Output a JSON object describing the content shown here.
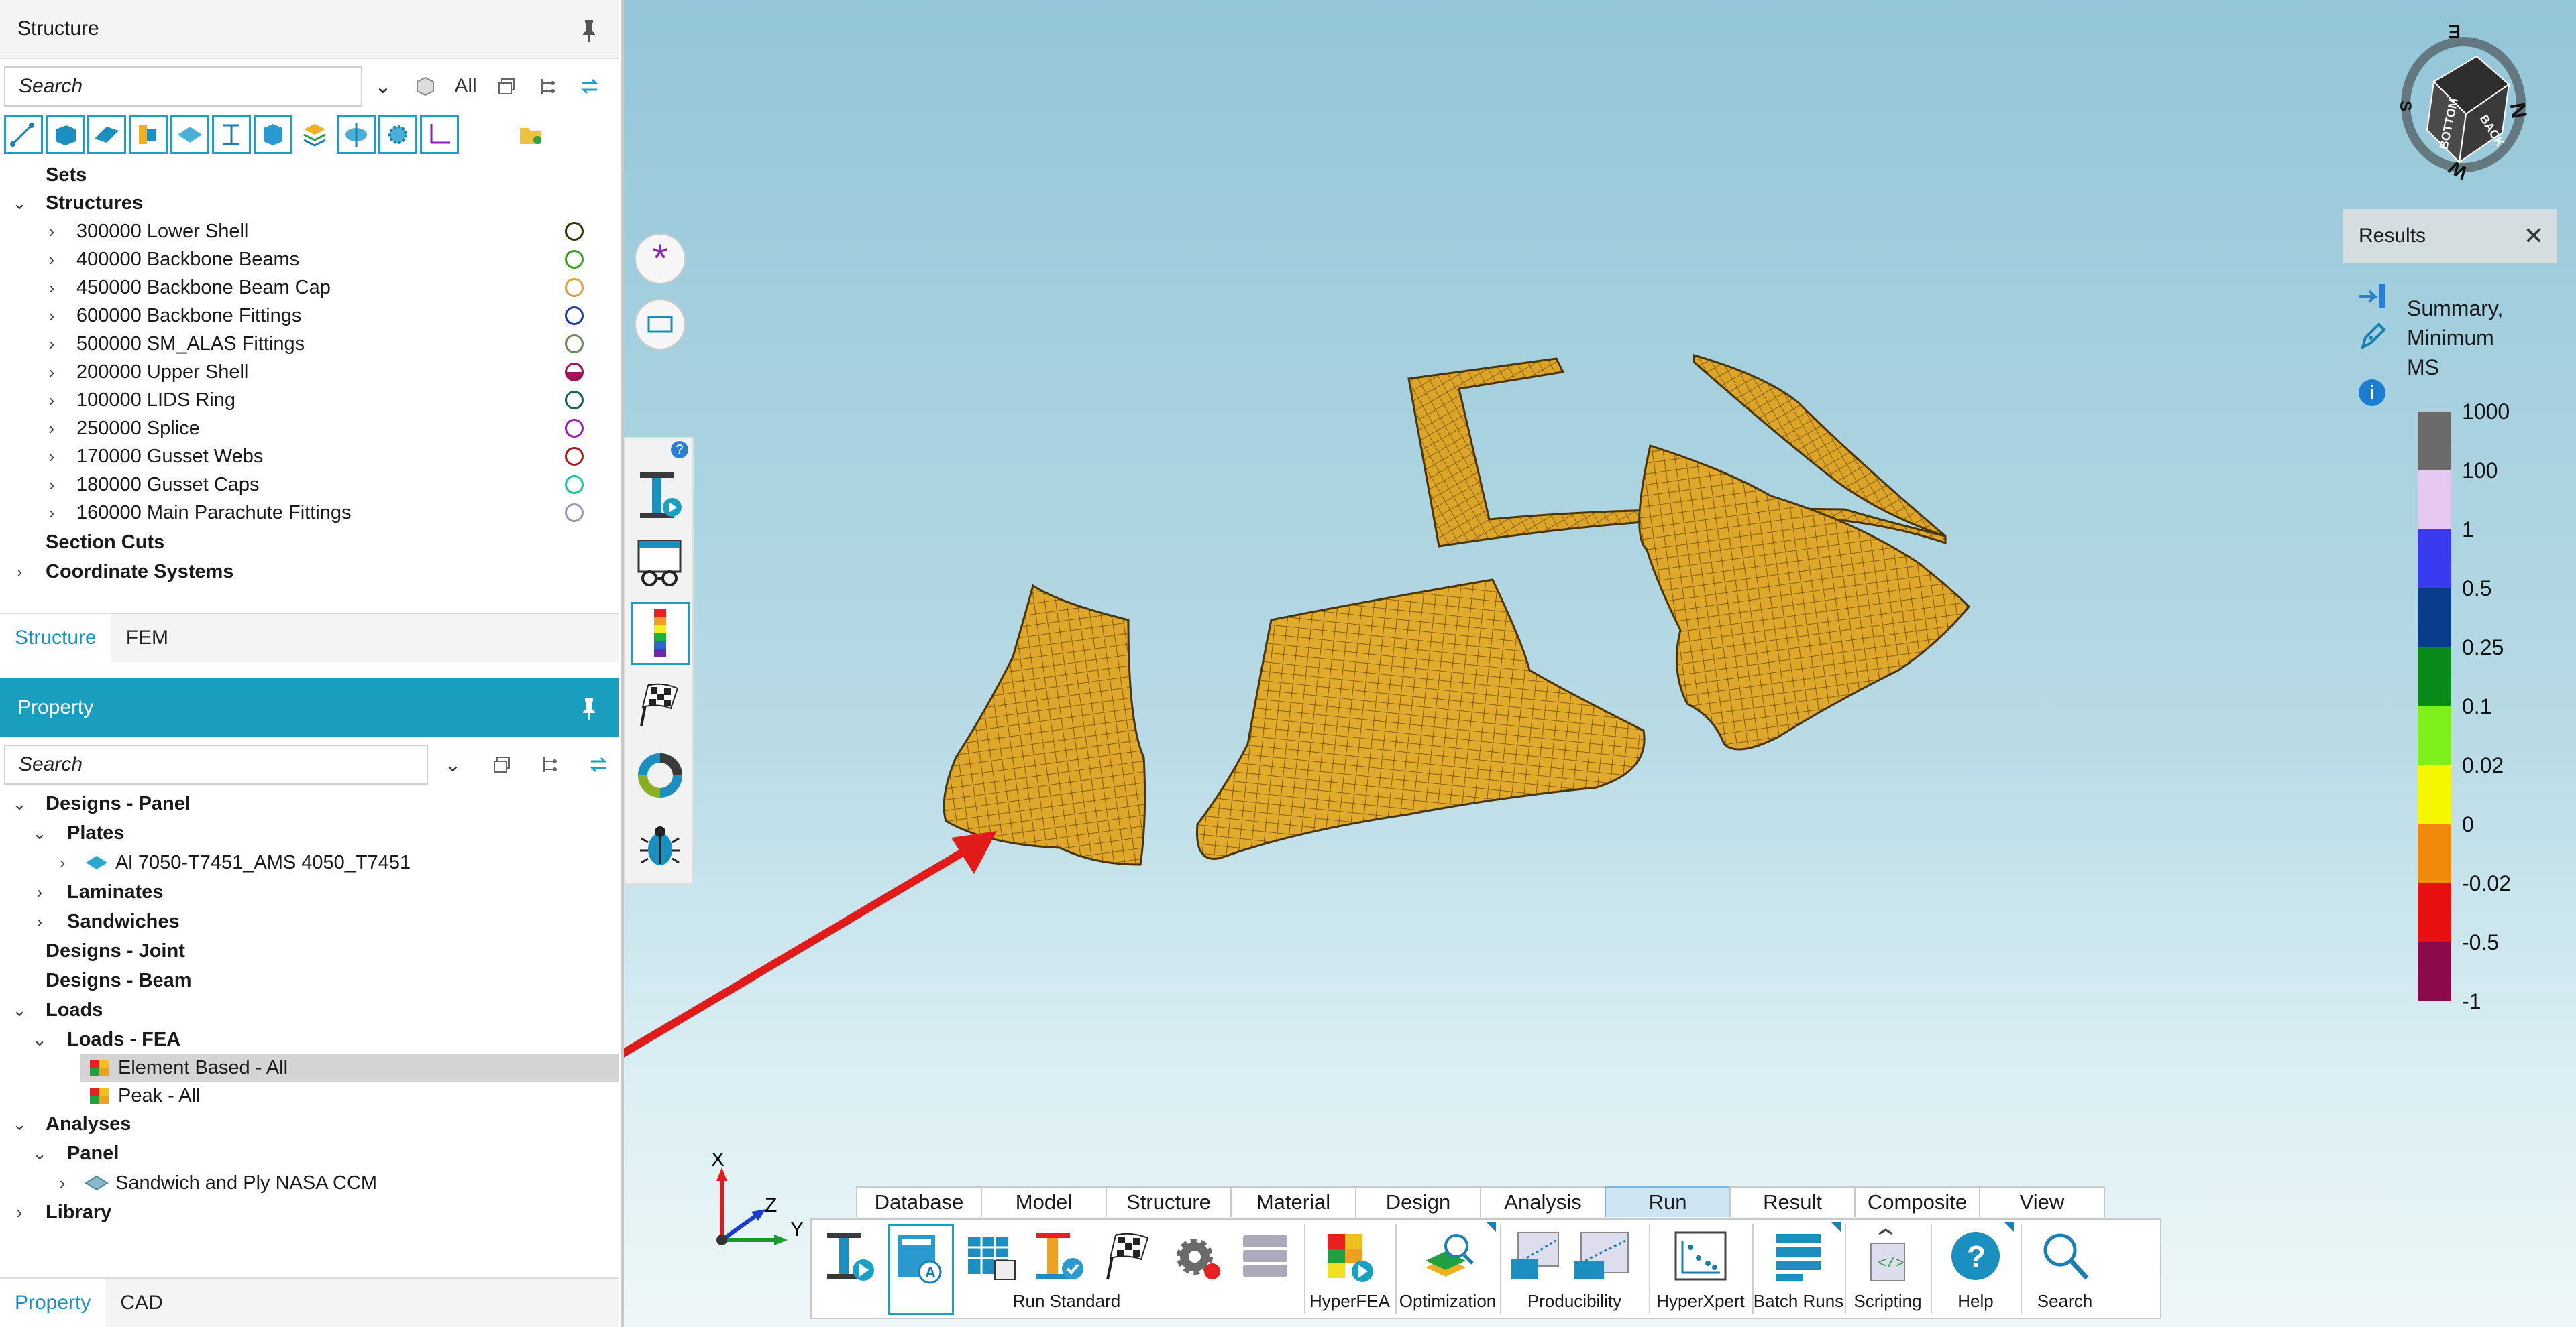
{
  "structure_panel": {
    "title": "Structure",
    "search_placeholder": "Search",
    "filter_all": "All",
    "tree": {
      "sets": "Sets",
      "structures": "Structures",
      "items": [
        {
          "label": "300000 Lower Shell",
          "color": "#2c3a0a",
          "half": false
        },
        {
          "label": "400000 Backbone Beams",
          "color": "#3aa020",
          "half": false
        },
        {
          "label": "450000 Backbone Beam Cap",
          "color": "#e0a040",
          "half": false
        },
        {
          "label": "600000 Backbone Fittings",
          "color": "#1c3c9a",
          "half": false
        },
        {
          "label": "500000 SM_ALAS Fittings",
          "color": "#6a8a5a",
          "half": false
        },
        {
          "label": "200000 Upper Shell",
          "color": "#a0145a",
          "half": true
        },
        {
          "label": "100000 LIDS Ring",
          "color": "#14605a",
          "half": false
        },
        {
          "label": "250000 Splice",
          "color": "#9a20b0",
          "half": false
        },
        {
          "label": "170000 Gusset Webs",
          "color": "#a82020",
          "half": false
        },
        {
          "label": "180000 Gusset Caps",
          "color": "#20c0a0",
          "half": false
        },
        {
          "label": "160000 Main Parachute Fittings",
          "color": "#9a9ab8",
          "half": false
        }
      ],
      "section_cuts": "Section Cuts",
      "coordinate_systems": "Coordinate Systems"
    },
    "tabs": [
      "Structure",
      "FEM"
    ]
  },
  "property_panel": {
    "title": "Property",
    "search_placeholder": "Search",
    "tree": {
      "designs_panel": "Designs - Panel",
      "plates": "Plates",
      "plate_item": "Al 7050-T7451_AMS 4050_T7451",
      "laminates": "Laminates",
      "sandwiches": "Sandwiches",
      "designs_joint": "Designs - Joint",
      "designs_beam": "Designs - Beam",
      "loads": "Loads",
      "loads_fea": "Loads - FEA",
      "element_based": "Element Based - All",
      "peak": "Peak - All",
      "analyses": "Analyses",
      "panel": "Panel",
      "sandwich_item": "Sandwich and Ply NASA CCM",
      "library": "Library"
    },
    "tabs": [
      "Property",
      "CAD"
    ]
  },
  "viewcube": {
    "faces": [
      "BOTTOM",
      "BACK"
    ],
    "compass": [
      "E",
      "S",
      "W",
      "N"
    ]
  },
  "results": {
    "title": "Results",
    "summary": "Summary,\nMinimum\nMS",
    "legend": [
      {
        "label": "1000",
        "color": "#6b6b6b"
      },
      {
        "label": "100",
        "color": "#e6c8f0"
      },
      {
        "label": "1",
        "color": "#3a3af0"
      },
      {
        "label": "0.5",
        "color": "#0a3c8c"
      },
      {
        "label": "0.25",
        "color": "#0a8a1a"
      },
      {
        "label": "0.1",
        "color": "#7ef01a"
      },
      {
        "label": "0.02",
        "color": "#f6f600"
      },
      {
        "label": "0",
        "color": "#f08a0a"
      },
      {
        "label": "-0.02",
        "color": "#e81010"
      },
      {
        "label": "-0.5",
        "color": "#8a0a4a"
      },
      {
        "label": "-1",
        "color": ""
      }
    ]
  },
  "triad": {
    "x": "X",
    "y": "Y",
    "z": "Z"
  },
  "ribbon": {
    "tabs": [
      "Database",
      "Model",
      "Structure",
      "Material",
      "Design",
      "Analysis",
      "Run",
      "Result",
      "Composite",
      "View"
    ],
    "active_tab": "Run",
    "groups": {
      "run_standard": "Run Standard",
      "hyperfea": "HyperFEA",
      "optimization": "Optimization",
      "producibility": "Producibility",
      "hyperxpert": "HyperXpert",
      "batch_runs": "Batch Runs",
      "scripting": "Scripting",
      "help": "Help",
      "search": "Search"
    }
  },
  "colors": {
    "accent": "#1aa0c3",
    "mesh": "#e0a82a",
    "arrow": "#e11a1a"
  }
}
